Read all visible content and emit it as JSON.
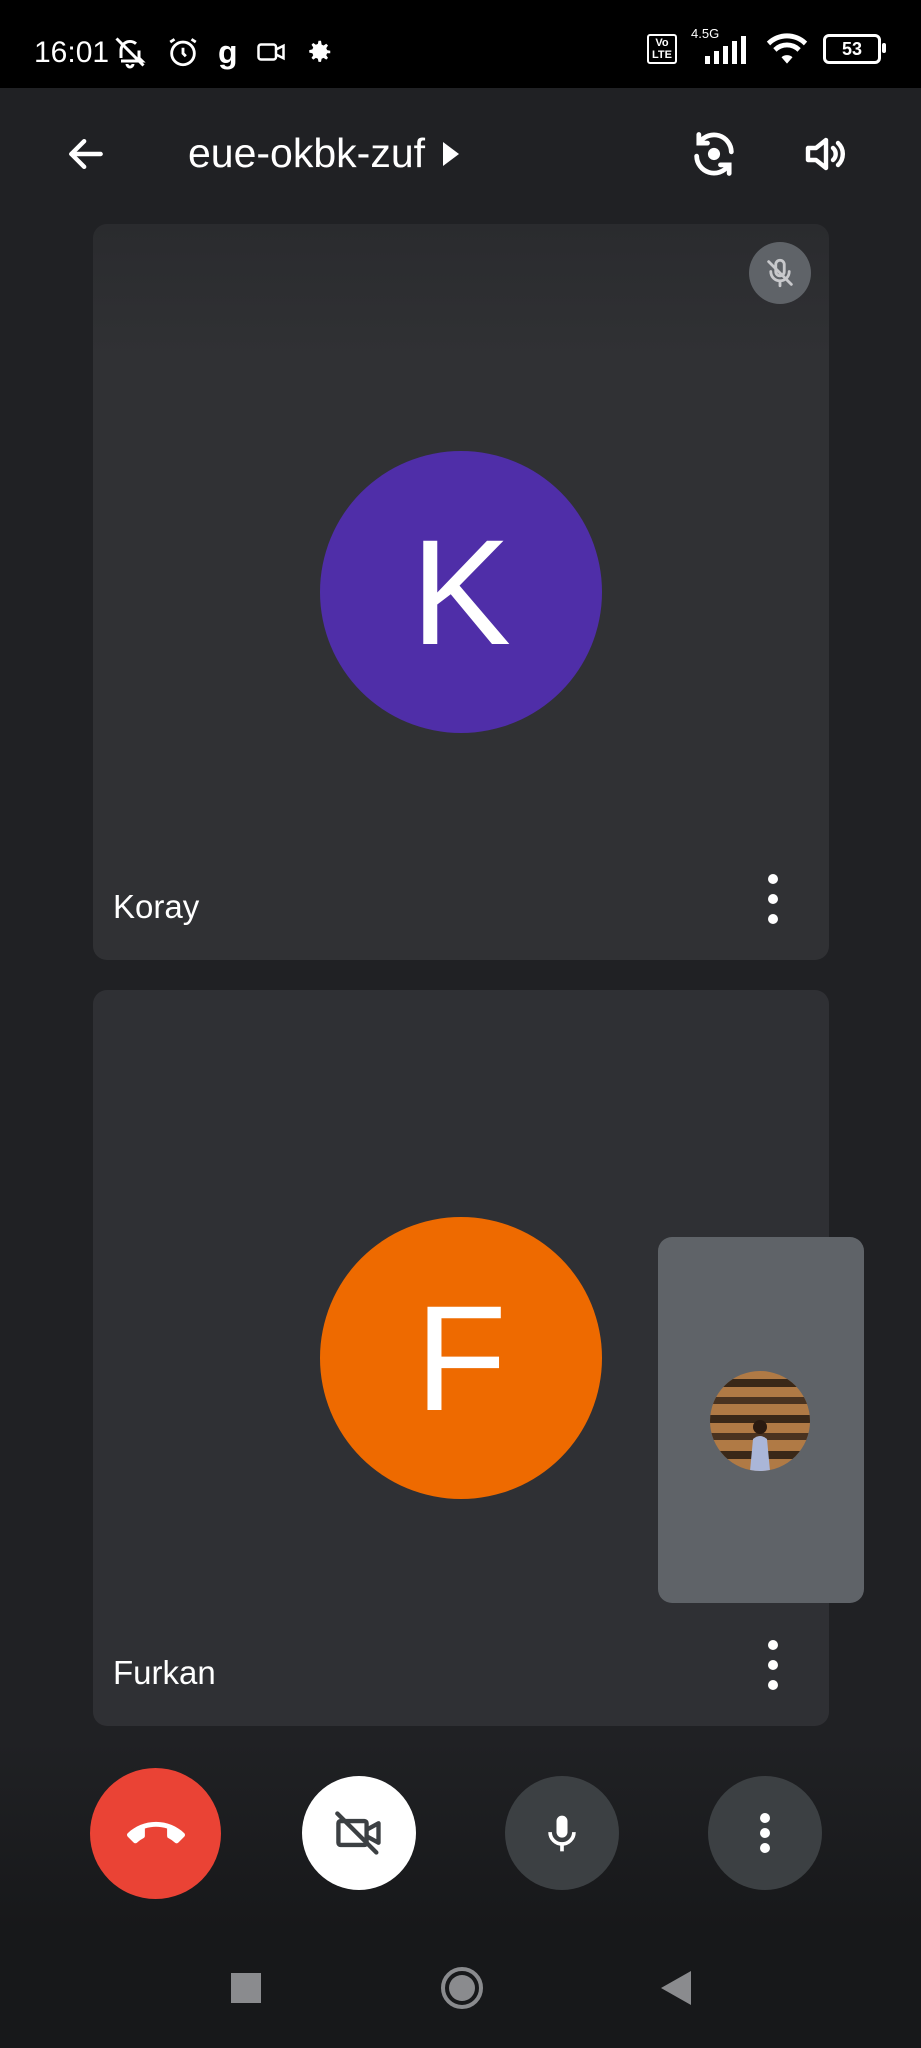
{
  "status_bar": {
    "time": "16:01",
    "g_letter": "g",
    "volte_line1": "Vo",
    "volte_line2": "LTE",
    "network": "4.5G",
    "battery": "53"
  },
  "top_bar": {
    "meeting_code": "eue-okbk-zuf"
  },
  "participants": [
    {
      "name": "Koray",
      "initial": "K",
      "avatar_color": "#4f2ea8",
      "muted": true
    },
    {
      "name": "Furkan",
      "initial": "F",
      "avatar_color": "#ee6a00",
      "muted": false
    }
  ],
  "controls": {
    "end_call_color": "#ea4335",
    "camera_state": "off",
    "mic_state": "on"
  },
  "icons": {
    "back": "arrow-left-icon",
    "meeting_details": "caret-right-icon",
    "switch_camera": "switch-camera-icon",
    "audio_output": "speaker-icon",
    "end_call": "end-call-icon",
    "camera": "camera-off-icon",
    "mic": "microphone-icon",
    "more": "more-vert-icon"
  }
}
